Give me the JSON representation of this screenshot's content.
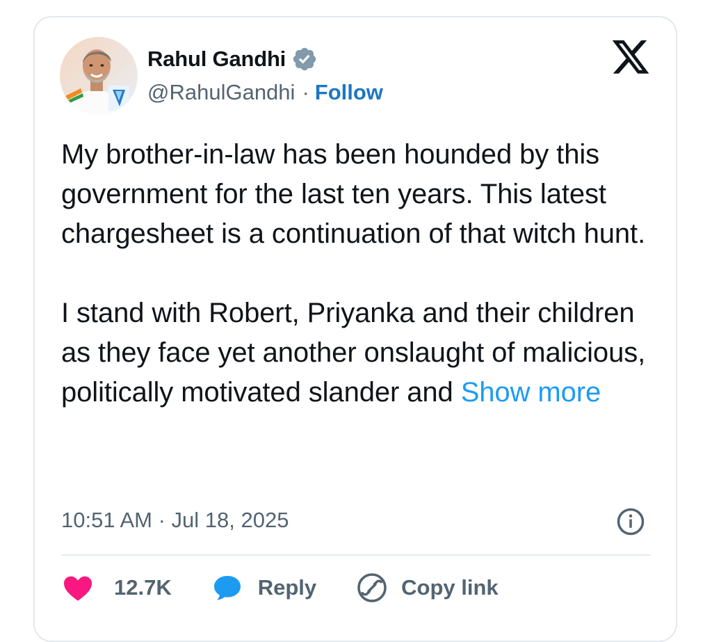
{
  "author": {
    "name": "Rahul Gandhi",
    "handle": "@RahulGandhi",
    "separator": "·",
    "follow_label": "Follow",
    "verified_icon": "verified-badge-icon",
    "avatar_icon": "user-avatar"
  },
  "platform": {
    "logo_icon": "x-logo-icon"
  },
  "tweet": {
    "paragraph_1": "My brother-in-law has been hounded by this government for the last ten years. This latest chargesheet is a continuation of that witch hunt.",
    "paragraph_2": "I stand with Robert, Priyanka and their children as they face yet another onslaught of malicious, politically motivated slander and",
    "show_more_label": "Show more",
    "timestamp": "10:51 AM · Jul 18, 2025"
  },
  "actions": {
    "like_count": "12.7K",
    "reply_label": "Reply",
    "copy_link_label": "Copy link"
  },
  "colors": {
    "text": "#0f1419",
    "muted": "#536471",
    "link": "#1d9bf0",
    "follow": "#1d76c3",
    "like": "#f91880",
    "reply": "#1d9bf0",
    "border": "#e3e8ec"
  }
}
